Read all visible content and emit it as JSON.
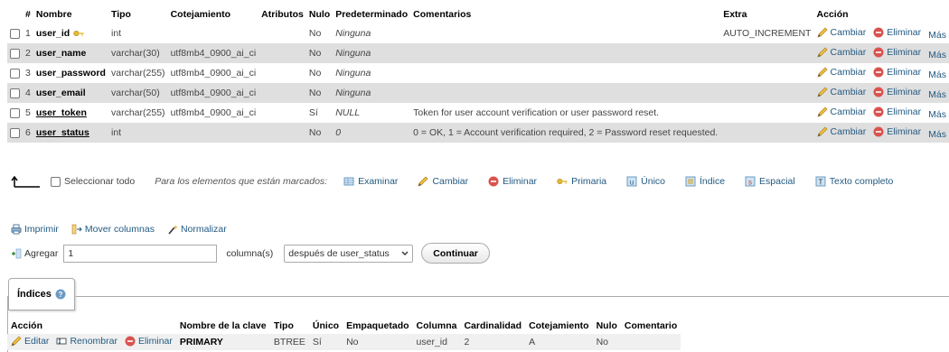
{
  "structure": {
    "headers": [
      "#",
      "Nombre",
      "Tipo",
      "Cotejamiento",
      "Atributos",
      "Nulo",
      "Predeterminado",
      "Comentarios",
      "Extra",
      "Acción"
    ],
    "rows": [
      {
        "num": "1",
        "name": "user_id",
        "type": "int",
        "collation": "",
        "attributes": "",
        "null": "No",
        "default": "Ninguna",
        "comment": "",
        "extra": "AUTO_INCREMENT"
      },
      {
        "num": "2",
        "name": "user_name",
        "type": "varchar(30)",
        "collation": "utf8mb4_0900_ai_ci",
        "attributes": "",
        "null": "No",
        "default": "Ninguna",
        "comment": "",
        "extra": ""
      },
      {
        "num": "3",
        "name": "user_password",
        "type": "varchar(255)",
        "collation": "utf8mb4_0900_ai_ci",
        "attributes": "",
        "null": "No",
        "default": "Ninguna",
        "comment": "",
        "extra": ""
      },
      {
        "num": "4",
        "name": "user_email",
        "type": "varchar(50)",
        "collation": "utf8mb4_0900_ai_ci",
        "attributes": "",
        "null": "No",
        "default": "Ninguna",
        "comment": "",
        "extra": ""
      },
      {
        "num": "5",
        "name": "user_token",
        "type": "varchar(255)",
        "collation": "utf8mb4_0900_ai_ci",
        "attributes": "",
        "null": "Sí",
        "default": "NULL",
        "comment": "Token for user account verification or user password reset.",
        "extra": ""
      },
      {
        "num": "6",
        "name": "user_status",
        "type": "int",
        "collation": "",
        "attributes": "",
        "null": "No",
        "default": "0",
        "comment": "0 = OK, 1 = Account verification required, 2 = Password reset requested.",
        "extra": ""
      }
    ],
    "actions": {
      "change": "Cambiar",
      "drop": "Eliminar",
      "more": "Más"
    }
  },
  "with_selected": {
    "select_all": "Seleccionar todo",
    "marked_label": "Para los elementos que están marcados:",
    "browse": "Examinar",
    "change": "Cambiar",
    "drop": "Eliminar",
    "primary": "Primaria",
    "unique": "Único",
    "index": "Índice",
    "spatial": "Espacial",
    "fulltext": "Texto completo"
  },
  "print_bar": {
    "print": "Imprimir",
    "move_columns": "Mover columnas",
    "normalize": "Normalizar"
  },
  "add_columns": {
    "label": "Agregar",
    "count": "1",
    "unit": "columna(s)",
    "position": "después de user_status",
    "go": "Continuar"
  },
  "indexes": {
    "legend": "Índices",
    "headers": [
      "Acción",
      "",
      "",
      "Nombre de la clave",
      "Tipo",
      "Único",
      "Empaquetado",
      "Columna",
      "Cardinalidad",
      "Cotejamiento",
      "Nulo",
      "Comentario"
    ],
    "row": {
      "edit": "Editar",
      "rename": "Renombrar",
      "drop": "Eliminar",
      "key_name": "PRIMARY",
      "type": "BTREE",
      "unique": "Sí",
      "packed": "No",
      "column": "user_id",
      "cardinality": "2",
      "collation": "A",
      "null": "No",
      "comment": ""
    }
  },
  "colors": {
    "link": "#235a81",
    "row_alt": "#dfdfdf",
    "drop_red": "#d9534f"
  }
}
